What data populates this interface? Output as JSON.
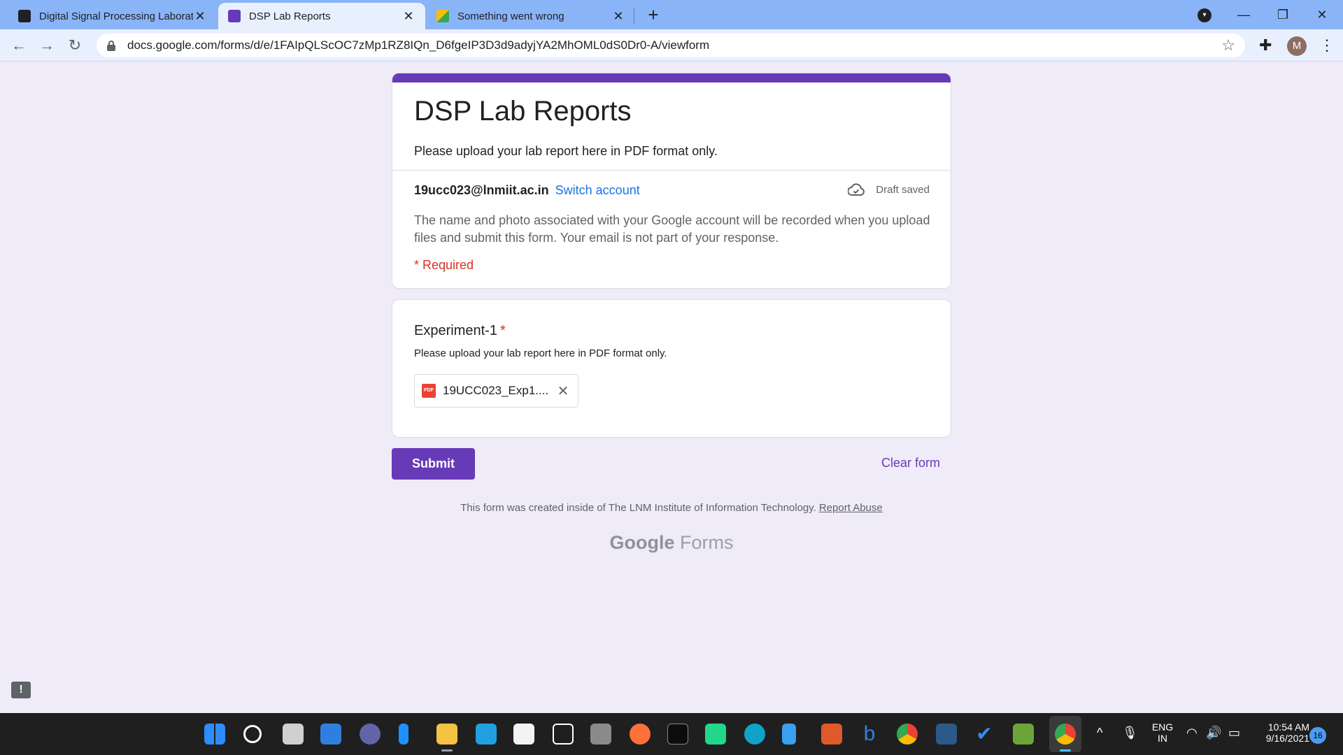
{
  "browser": {
    "tabs": [
      {
        "title": "Digital Signal Processing Laborat",
        "active": false
      },
      {
        "title": "DSP Lab Reports",
        "active": true
      },
      {
        "title": "Something went wrong",
        "active": false
      }
    ],
    "url": "docs.google.com/forms/d/e/1FAIpQLScOC7zMp1RZ8IQn_D6fgeIP3D3d9adyjYA2MhOML0dS0Dr0-A/viewform",
    "profile_initial": "M"
  },
  "form": {
    "title": "DSP Lab Reports",
    "description": "Please upload your lab report here in PDF format only.",
    "account_email": "19ucc023@lnmiit.ac.in",
    "switch_account_label": "Switch account",
    "draft_status": "Draft saved",
    "notice": "The name and photo associated with your Google account will be recorded when you upload files and submit this form. Your email is not part of your response.",
    "required_label": "* Required"
  },
  "question": {
    "title": "Experiment-1",
    "required_mark": "*",
    "description": "Please upload your lab report here in PDF format only.",
    "file_type_label": "PDF",
    "file_name": "19UCC023_Exp1...."
  },
  "actions": {
    "submit_label": "Submit",
    "clear_label": "Clear form"
  },
  "footer": {
    "note": "This form was created inside of The LNM Institute of Information Technology.",
    "report_abuse": "Report Abuse",
    "brand_google": "Google",
    "brand_forms": "Forms"
  },
  "taskbar": {
    "language": "ENG",
    "region": "IN",
    "time": "10:54 AM",
    "date": "9/16/2021",
    "notification_count": "16"
  },
  "colors": {
    "accent": "#673ab7",
    "page_bg": "#f0ebf8",
    "required": "#d93025",
    "link": "#1a73e8"
  }
}
